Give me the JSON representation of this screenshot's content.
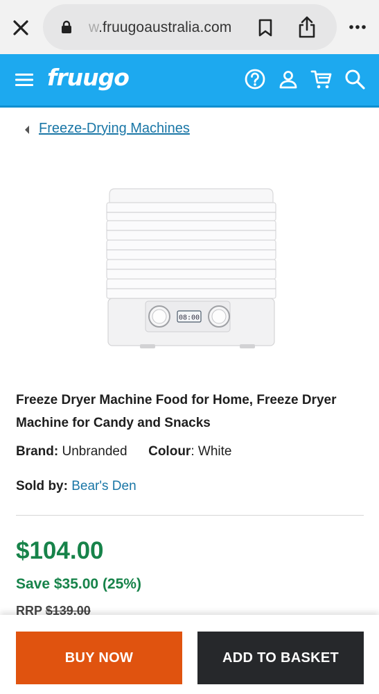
{
  "browser": {
    "url": ".fruugoaustralia.com",
    "url_prefix_faded": "w"
  },
  "header": {
    "logo_text": "fruugo",
    "icons": [
      "menu-icon",
      "help-icon",
      "account-icon",
      "cart-icon",
      "search-icon"
    ],
    "bg_color": "#1da9ef"
  },
  "breadcrumb": {
    "label": "Freeze-Drying Machines"
  },
  "product": {
    "title": "Freeze Dryer Machine Food for Home, Freeze Dryer Machine for Candy and Snacks",
    "brand_label": "Brand:",
    "brand_value": "Unbranded",
    "colour_label": "Colour",
    "colour_value": "White",
    "sold_by_label": "Sold by:",
    "seller": "Bear's Den",
    "price": "$104.00",
    "save_text": "Save $35.00 (25%)",
    "rrp_label": "RRP",
    "rrp_value": "$139.00",
    "display_text": "08:00",
    "price_color": "#17834a"
  },
  "actions": {
    "buy_now": "BUY NOW",
    "add_to_basket": "ADD TO BASKET",
    "buy_color": "#e0530f",
    "basket_color": "#26282b"
  }
}
